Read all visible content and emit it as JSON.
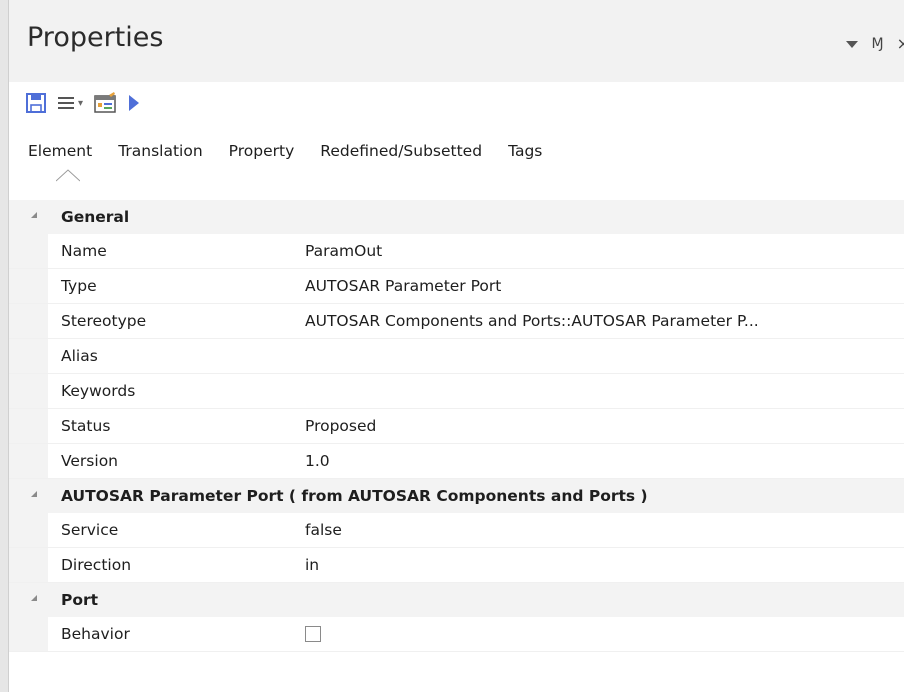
{
  "window": {
    "title": "Properties",
    "controls": {
      "dropdown_icon": "chevron-down-icon",
      "pin_label": "Ɱ",
      "close_label": "×"
    }
  },
  "toolbar": {
    "buttons": [
      {
        "name": "save",
        "icon": "save-icon"
      },
      {
        "name": "menu",
        "icon": "hamburger-menu-icon"
      },
      {
        "name": "properties-dialog",
        "icon": "properties-dialog-icon"
      },
      {
        "name": "run",
        "icon": "play-icon"
      }
    ],
    "accent": "#4f6fd8"
  },
  "tabs": [
    "Element",
    "Translation",
    "Property",
    "Redefined/Subsetted",
    "Tags"
  ],
  "active_tab": "Element",
  "sections": [
    {
      "title": "General",
      "items": [
        {
          "name": "Name",
          "value": "ParamOut"
        },
        {
          "name": "Type",
          "value": "AUTOSAR Parameter Port"
        },
        {
          "name": "Stereotype",
          "value": "AUTOSAR Components and Ports::AUTOSAR Parameter P..."
        },
        {
          "name": "Alias",
          "value": ""
        },
        {
          "name": "Keywords",
          "value": ""
        },
        {
          "name": "Status",
          "value": "Proposed"
        },
        {
          "name": "Version",
          "value": "1.0"
        }
      ]
    },
    {
      "title": "AUTOSAR Parameter Port  ( from AUTOSAR Components and Ports )",
      "items": [
        {
          "name": "Service",
          "value": "false"
        },
        {
          "name": "Direction",
          "value": "in"
        }
      ]
    },
    {
      "title": "Port",
      "items": [
        {
          "name": "Behavior",
          "value": "",
          "checkbox": true,
          "checked": false
        }
      ]
    }
  ]
}
